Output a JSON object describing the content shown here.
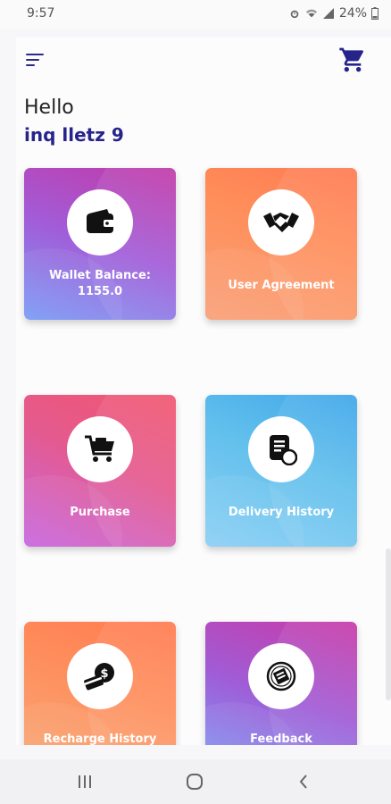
{
  "status": {
    "time": "9:57",
    "battery": "24%"
  },
  "header": {
    "menu_icon": "hamburger-menu-icon",
    "cart_icon": "shopping-cart-icon",
    "accent": "#26248a"
  },
  "greeting": {
    "hello": "Hello",
    "username": "inq lletz 9"
  },
  "tiles": [
    {
      "label": "Wallet Balance:\n1155.0",
      "icon": "wallet-icon"
    },
    {
      "label": "User Agreement",
      "icon": "handshake-icon"
    },
    {
      "label": "Purchase",
      "icon": "shopping-cart-icon"
    },
    {
      "label": "Delivery History",
      "icon": "delivery-document-icon"
    },
    {
      "label": "Recharge History",
      "icon": "coin-card-icon"
    },
    {
      "label": "Feedback",
      "icon": "feedback-icon"
    }
  ],
  "navbar": {
    "recents": "recent-apps-icon",
    "home": "home-icon",
    "back": "back-icon"
  }
}
